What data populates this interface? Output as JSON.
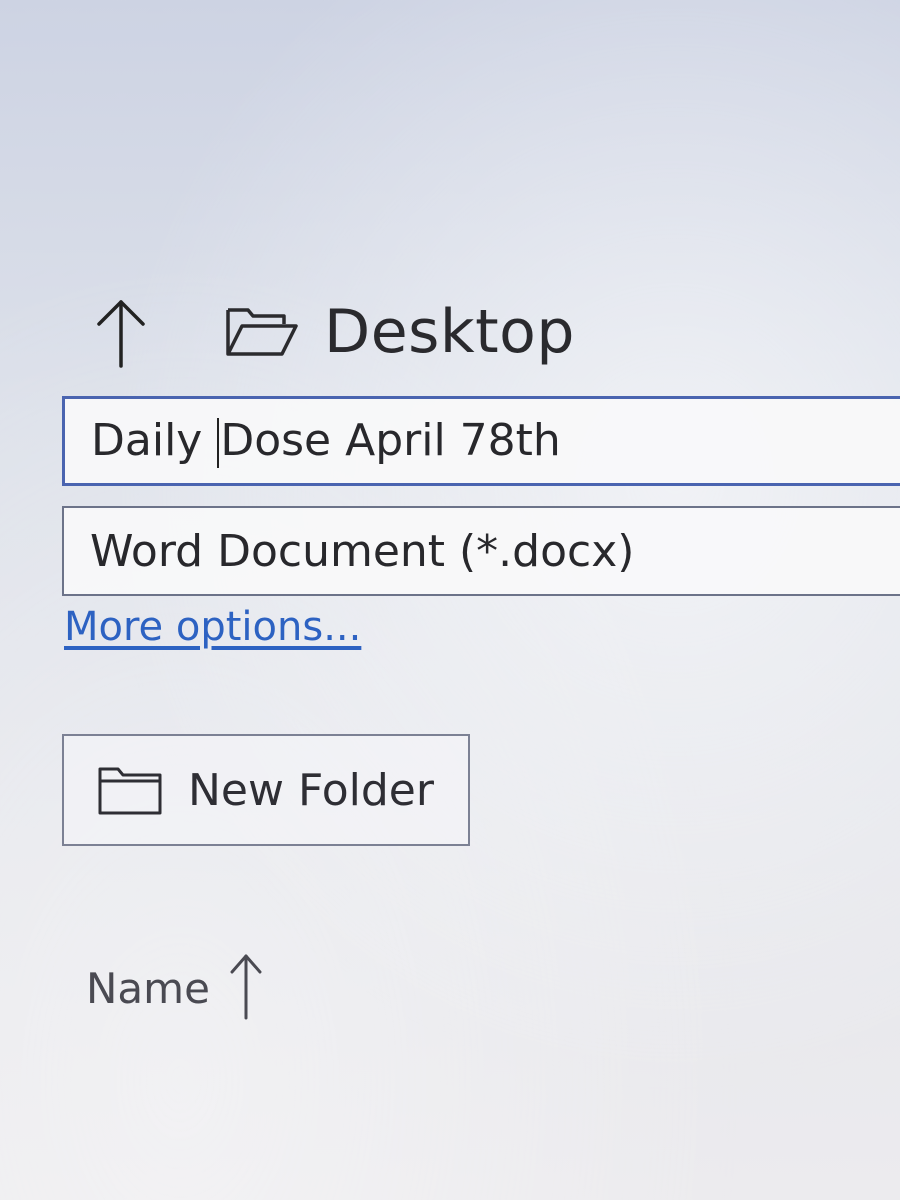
{
  "navigation": {
    "up_icon": "arrow-up-icon",
    "folder_icon": "folder-open-icon",
    "location": "Desktop"
  },
  "file_name": {
    "value_before_caret": "Daily ",
    "value_after_caret": "Dose April 78th"
  },
  "file_type": {
    "selected": "Word Document (*.docx)"
  },
  "more_options": {
    "label": "More options..."
  },
  "new_folder": {
    "icon": "folder-icon",
    "label": "New Folder"
  },
  "list_header": {
    "column": "Name",
    "sort_icon": "sort-ascending-arrow-icon"
  },
  "colors": {
    "accent_border": "#4a64b0",
    "link": "#2d62c2"
  }
}
